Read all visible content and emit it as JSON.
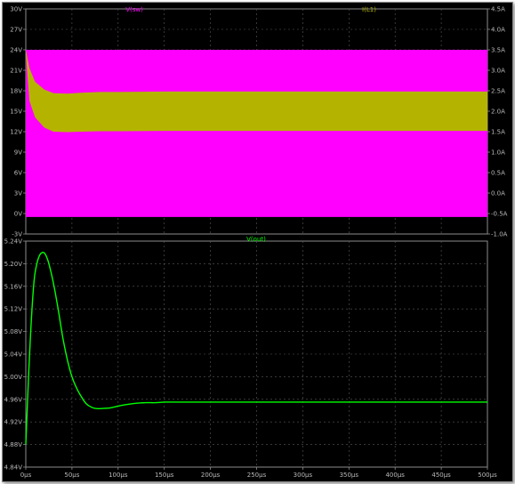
{
  "pane_top": {
    "trace_labels": [
      {
        "text": "V(sw)",
        "color": "#ff00ff"
      },
      {
        "text": "I(L1)",
        "color": "#b4b400"
      }
    ],
    "left_axis": {
      "unit": "V",
      "min": -3,
      "max": 30,
      "ticks": [
        "30V",
        "27V",
        "24V",
        "21V",
        "18V",
        "15V",
        "12V",
        "9V",
        "6V",
        "3V",
        "0V",
        "-3V"
      ]
    },
    "right_axis": {
      "unit": "A",
      "min": -1.0,
      "max": 4.5,
      "ticks": [
        "4.5A",
        "4.0A",
        "3.5A",
        "3.0A",
        "2.5A",
        "2.0A",
        "1.5A",
        "1.0A",
        "0.5A",
        "0.0A",
        "-0.5A",
        "-1.0A"
      ]
    }
  },
  "pane_bottom": {
    "trace_label": {
      "text": "V(out)",
      "color": "#00ff00"
    },
    "left_axis": {
      "unit": "V",
      "min": 4.84,
      "max": 5.24,
      "ticks": [
        "5.24V",
        "5.20V",
        "5.16V",
        "5.12V",
        "5.08V",
        "5.04V",
        "5.00V",
        "4.96V",
        "4.92V",
        "4.88V",
        "4.84V"
      ]
    }
  },
  "x_axis": {
    "unit": "µs",
    "min": 0,
    "max": 500,
    "ticks": [
      "0µs",
      "50µs",
      "100µs",
      "150µs",
      "200µs",
      "250µs",
      "300µs",
      "350µs",
      "400µs",
      "450µs",
      "500µs"
    ]
  },
  "chart_data": [
    {
      "type": "area",
      "title": "",
      "xlabel": "",
      "ylabel": "",
      "xlim": [
        0,
        500
      ],
      "ylim": [
        -3,
        30
      ],
      "y2lim": [
        -1.0,
        4.5
      ],
      "series": [
        {
          "name": "V(sw)",
          "color": "#ff00ff",
          "axis": "left",
          "x": [
            0,
            500
          ],
          "y_min": [
            -0.5,
            -0.5
          ],
          "y_max": [
            24,
            24
          ]
        },
        {
          "name": "I(L1)",
          "color": "#b4b400",
          "axis": "right",
          "x": [
            0,
            4,
            10,
            20,
            30,
            45,
            60,
            80,
            100,
            150,
            200,
            300,
            500
          ],
          "y_min": [
            3.4,
            2.25,
            1.85,
            1.6,
            1.5,
            1.49,
            1.5,
            1.51,
            1.51,
            1.52,
            1.52,
            1.52,
            1.52
          ],
          "y_max": [
            3.5,
            3.05,
            2.72,
            2.53,
            2.44,
            2.43,
            2.45,
            2.47,
            2.47,
            2.48,
            2.48,
            2.48,
            2.48
          ]
        }
      ]
    },
    {
      "type": "line",
      "title": "",
      "xlabel": "",
      "ylabel": "",
      "xlim": [
        0,
        500
      ],
      "ylim": [
        4.84,
        5.24
      ],
      "series": [
        {
          "name": "V(out)",
          "color": "#00ff00",
          "x": [
            0,
            3,
            6,
            9,
            12,
            15,
            18,
            20,
            22,
            25,
            30,
            35,
            40,
            45,
            50,
            55,
            60,
            65,
            70,
            75,
            80,
            85,
            90,
            95,
            100,
            110,
            120,
            130,
            140,
            150,
            160,
            180,
            200,
            250,
            300,
            400,
            500
          ],
          "y": [
            4.88,
            5.0,
            5.1,
            5.17,
            5.2,
            5.215,
            5.22,
            5.219,
            5.214,
            5.2,
            5.165,
            5.12,
            5.07,
            5.03,
            5.0,
            4.98,
            4.965,
            4.953,
            4.947,
            4.944,
            4.9435,
            4.944,
            4.9445,
            4.946,
            4.948,
            4.951,
            4.953,
            4.954,
            4.954,
            4.955,
            4.955,
            4.955,
            4.955,
            4.955,
            4.955,
            4.955,
            4.955
          ]
        }
      ]
    }
  ]
}
